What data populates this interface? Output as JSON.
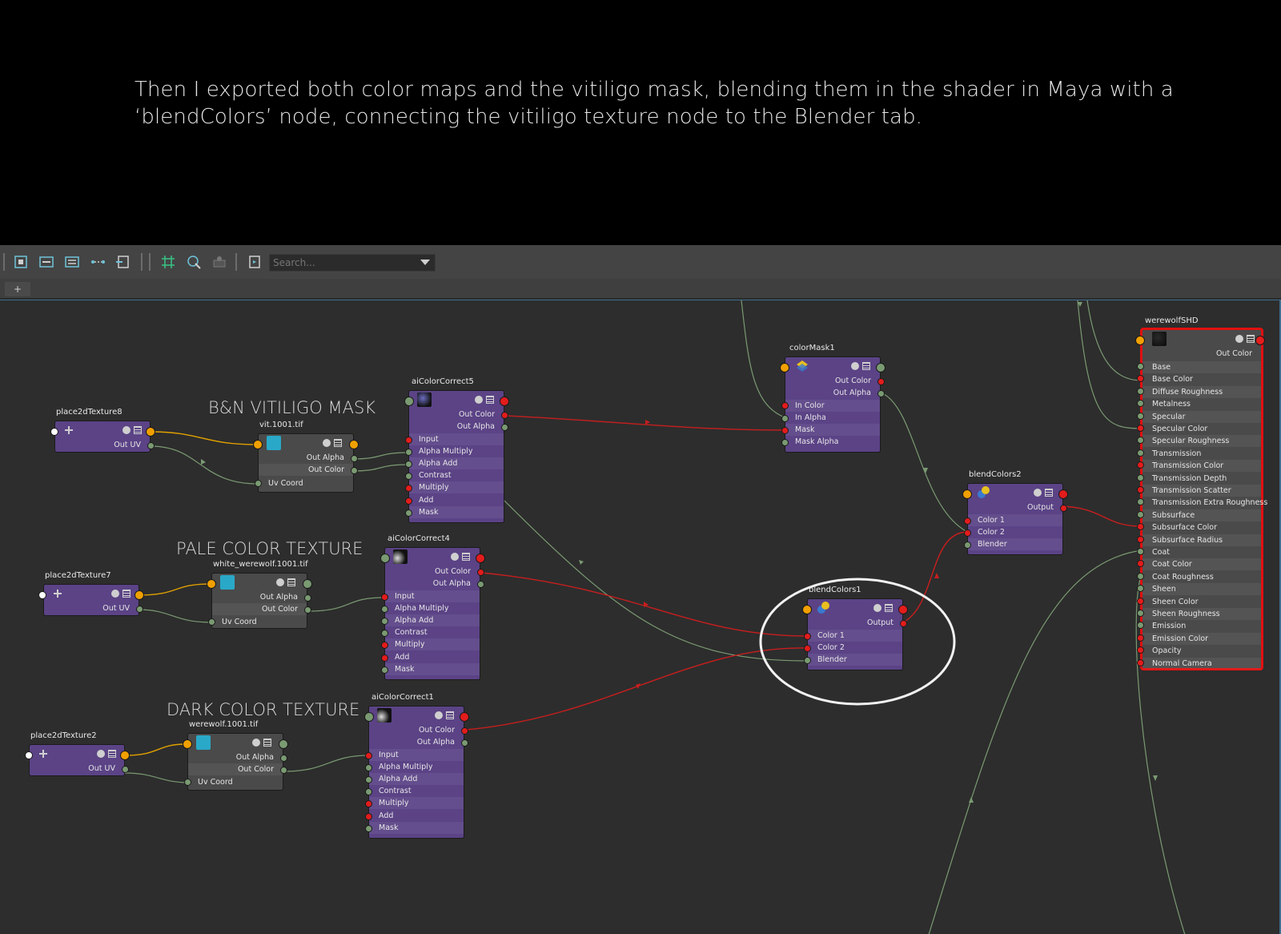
{
  "caption": "Then I exported both color maps and the vitiligo mask, blending them in the shader in Maya with a ‘blendColors’ node, connecting the vitiligo texture node to the Blender tab.",
  "toolbar": {
    "search_placeholder": "Search...",
    "icons": [
      "frame-all-icon",
      "layout-icon",
      "graph-down-icon",
      "graph-up-icon",
      "clear-graph-icon",
      "grid-icon",
      "snap-icon",
      "hierarchy-icon",
      "refresh-icon"
    ]
  },
  "tabs": {
    "add_label": "+"
  },
  "colors": {
    "node_purple": "#5b4386",
    "node_grey": "#4a4a4a",
    "wire_red": "#c81e1e",
    "wire_green": "#7a9a72",
    "wire_orange": "#e0a000",
    "selection_red": "#e01010",
    "annotation_circle": "#f2f2f2"
  },
  "groups": {
    "vitiligo": "B&N VITILIGO MASK",
    "pale": "PALE COLOR TEXTURE",
    "dark": "DARK COLOR TEXTURE"
  },
  "nodes": {
    "place8": {
      "title": "place2dTexture8",
      "out": "Out UV"
    },
    "place7": {
      "title": "place2dTexture7",
      "out": "Out UV"
    },
    "place2": {
      "title": "place2dTexture2",
      "out": "Out UV"
    },
    "vit": {
      "title": "vit.1001.tif",
      "rows": [
        "Out Alpha",
        "Out Color",
        "Uv Coord"
      ]
    },
    "white": {
      "title": "white_werewolf.1001.tif",
      "rows": [
        "Out Alpha",
        "Out Color",
        "Uv Coord"
      ]
    },
    "werewolf": {
      "title": "werewolf.1001.tif",
      "rows": [
        "Out Alpha",
        "Out Color",
        "Uv Coord"
      ]
    },
    "cc5": {
      "title": "aiColorCorrect5",
      "rows": [
        "Out Color",
        "Out Alpha",
        "Input",
        "Alpha Multiply",
        "Alpha Add",
        "Contrast",
        "Multiply",
        "Add",
        "Mask"
      ]
    },
    "cc4": {
      "title": "aiColorCorrect4",
      "rows": [
        "Out Color",
        "Out Alpha",
        "Input",
        "Alpha Multiply",
        "Alpha Add",
        "Contrast",
        "Multiply",
        "Add",
        "Mask"
      ]
    },
    "cc1": {
      "title": "aiColorCorrect1",
      "rows": [
        "Out Color",
        "Out Alpha",
        "Input",
        "Alpha Multiply",
        "Alpha Add",
        "Contrast",
        "Multiply",
        "Add",
        "Mask"
      ]
    },
    "mask1": {
      "title": "colorMask1",
      "rows": [
        "Out Color",
        "Out Alpha",
        "In Color",
        "In Alpha",
        "Mask",
        "Mask Alpha"
      ]
    },
    "blend2": {
      "title": "blendColors2",
      "rows": [
        "Output",
        "Color 1",
        "Color 2",
        "Blender"
      ]
    },
    "blend1": {
      "title": "blendColors1",
      "rows": [
        "Output",
        "Color 1",
        "Color 2",
        "Blender"
      ]
    },
    "shd": {
      "title": "werewolfSHD",
      "out": "Out Color",
      "rows": [
        "Base",
        "Base Color",
        "Diffuse Roughness",
        "Metalness",
        "Specular",
        "Specular Color",
        "Specular Roughness",
        "Transmission",
        "Transmission Color",
        "Transmission Depth",
        "Transmission Scatter",
        "Transmission Extra Roughness",
        "Subsurface",
        "Subsurface Color",
        "Subsurface Radius",
        "Coat",
        "Coat Color",
        "Coat Roughness",
        "Sheen",
        "Sheen Color",
        "Sheen Roughness",
        "Emission",
        "Emission Color",
        "Opacity",
        "Normal Camera"
      ]
    }
  }
}
